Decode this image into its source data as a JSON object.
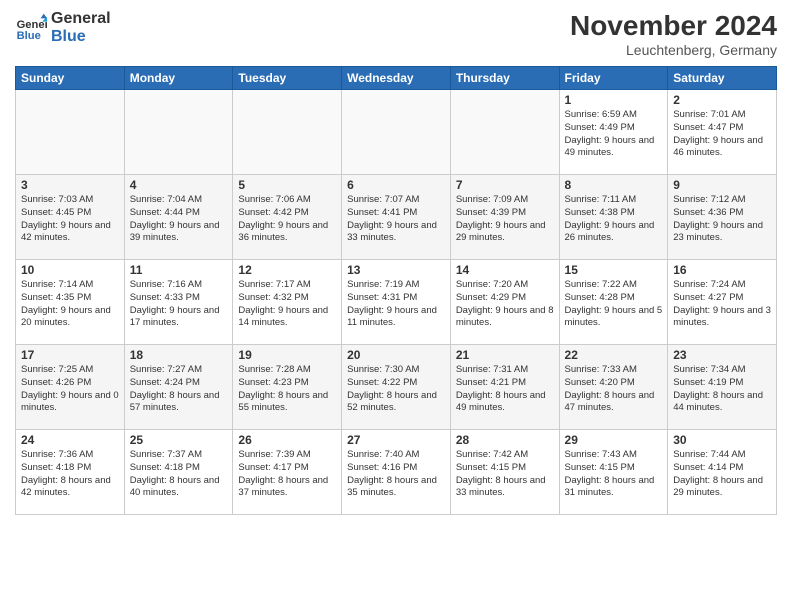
{
  "logo": {
    "line1": "General",
    "line2": "Blue"
  },
  "title": "November 2024",
  "location": "Leuchtenberg, Germany",
  "days_of_week": [
    "Sunday",
    "Monday",
    "Tuesday",
    "Wednesday",
    "Thursday",
    "Friday",
    "Saturday"
  ],
  "weeks": [
    [
      {
        "day": "",
        "info": ""
      },
      {
        "day": "",
        "info": ""
      },
      {
        "day": "",
        "info": ""
      },
      {
        "day": "",
        "info": ""
      },
      {
        "day": "",
        "info": ""
      },
      {
        "day": "1",
        "info": "Sunrise: 6:59 AM\nSunset: 4:49 PM\nDaylight: 9 hours and 49 minutes."
      },
      {
        "day": "2",
        "info": "Sunrise: 7:01 AM\nSunset: 4:47 PM\nDaylight: 9 hours and 46 minutes."
      }
    ],
    [
      {
        "day": "3",
        "info": "Sunrise: 7:03 AM\nSunset: 4:45 PM\nDaylight: 9 hours and 42 minutes."
      },
      {
        "day": "4",
        "info": "Sunrise: 7:04 AM\nSunset: 4:44 PM\nDaylight: 9 hours and 39 minutes."
      },
      {
        "day": "5",
        "info": "Sunrise: 7:06 AM\nSunset: 4:42 PM\nDaylight: 9 hours and 36 minutes."
      },
      {
        "day": "6",
        "info": "Sunrise: 7:07 AM\nSunset: 4:41 PM\nDaylight: 9 hours and 33 minutes."
      },
      {
        "day": "7",
        "info": "Sunrise: 7:09 AM\nSunset: 4:39 PM\nDaylight: 9 hours and 29 minutes."
      },
      {
        "day": "8",
        "info": "Sunrise: 7:11 AM\nSunset: 4:38 PM\nDaylight: 9 hours and 26 minutes."
      },
      {
        "day": "9",
        "info": "Sunrise: 7:12 AM\nSunset: 4:36 PM\nDaylight: 9 hours and 23 minutes."
      }
    ],
    [
      {
        "day": "10",
        "info": "Sunrise: 7:14 AM\nSunset: 4:35 PM\nDaylight: 9 hours and 20 minutes."
      },
      {
        "day": "11",
        "info": "Sunrise: 7:16 AM\nSunset: 4:33 PM\nDaylight: 9 hours and 17 minutes."
      },
      {
        "day": "12",
        "info": "Sunrise: 7:17 AM\nSunset: 4:32 PM\nDaylight: 9 hours and 14 minutes."
      },
      {
        "day": "13",
        "info": "Sunrise: 7:19 AM\nSunset: 4:31 PM\nDaylight: 9 hours and 11 minutes."
      },
      {
        "day": "14",
        "info": "Sunrise: 7:20 AM\nSunset: 4:29 PM\nDaylight: 9 hours and 8 minutes."
      },
      {
        "day": "15",
        "info": "Sunrise: 7:22 AM\nSunset: 4:28 PM\nDaylight: 9 hours and 5 minutes."
      },
      {
        "day": "16",
        "info": "Sunrise: 7:24 AM\nSunset: 4:27 PM\nDaylight: 9 hours and 3 minutes."
      }
    ],
    [
      {
        "day": "17",
        "info": "Sunrise: 7:25 AM\nSunset: 4:26 PM\nDaylight: 9 hours and 0 minutes."
      },
      {
        "day": "18",
        "info": "Sunrise: 7:27 AM\nSunset: 4:24 PM\nDaylight: 8 hours and 57 minutes."
      },
      {
        "day": "19",
        "info": "Sunrise: 7:28 AM\nSunset: 4:23 PM\nDaylight: 8 hours and 55 minutes."
      },
      {
        "day": "20",
        "info": "Sunrise: 7:30 AM\nSunset: 4:22 PM\nDaylight: 8 hours and 52 minutes."
      },
      {
        "day": "21",
        "info": "Sunrise: 7:31 AM\nSunset: 4:21 PM\nDaylight: 8 hours and 49 minutes."
      },
      {
        "day": "22",
        "info": "Sunrise: 7:33 AM\nSunset: 4:20 PM\nDaylight: 8 hours and 47 minutes."
      },
      {
        "day": "23",
        "info": "Sunrise: 7:34 AM\nSunset: 4:19 PM\nDaylight: 8 hours and 44 minutes."
      }
    ],
    [
      {
        "day": "24",
        "info": "Sunrise: 7:36 AM\nSunset: 4:18 PM\nDaylight: 8 hours and 42 minutes."
      },
      {
        "day": "25",
        "info": "Sunrise: 7:37 AM\nSunset: 4:18 PM\nDaylight: 8 hours and 40 minutes."
      },
      {
        "day": "26",
        "info": "Sunrise: 7:39 AM\nSunset: 4:17 PM\nDaylight: 8 hours and 37 minutes."
      },
      {
        "day": "27",
        "info": "Sunrise: 7:40 AM\nSunset: 4:16 PM\nDaylight: 8 hours and 35 minutes."
      },
      {
        "day": "28",
        "info": "Sunrise: 7:42 AM\nSunset: 4:15 PM\nDaylight: 8 hours and 33 minutes."
      },
      {
        "day": "29",
        "info": "Sunrise: 7:43 AM\nSunset: 4:15 PM\nDaylight: 8 hours and 31 minutes."
      },
      {
        "day": "30",
        "info": "Sunrise: 7:44 AM\nSunset: 4:14 PM\nDaylight: 8 hours and 29 minutes."
      }
    ]
  ]
}
